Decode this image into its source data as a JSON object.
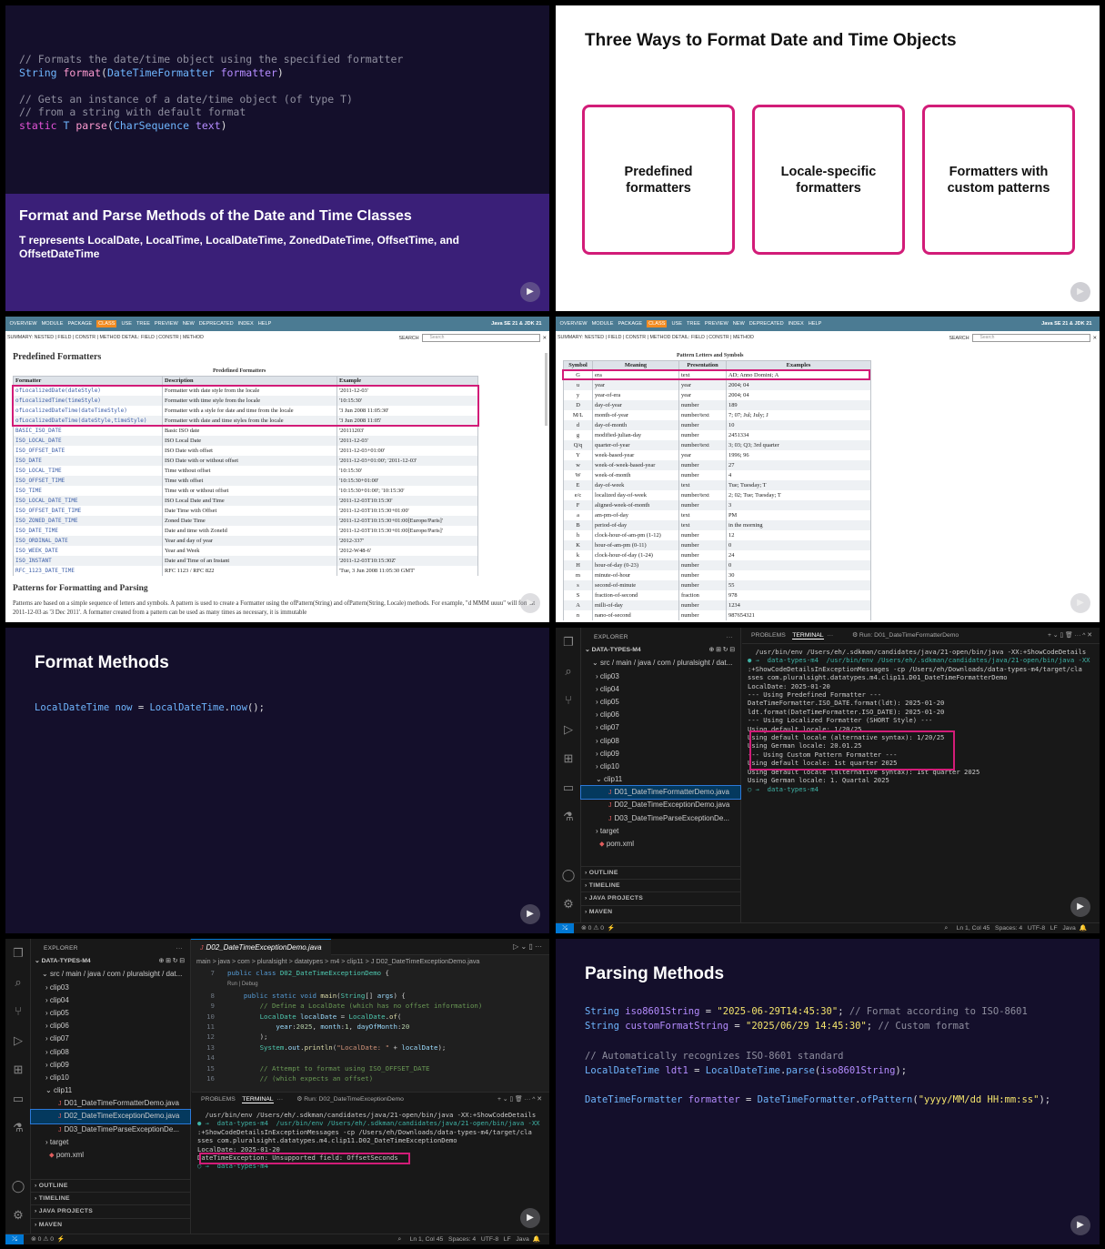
{
  "p1": {
    "code": [
      {
        "comment": "// Formats the date/time object using the specified formatter"
      },
      {
        "sig": [
          "String",
          "format",
          "DateTimeFormatter",
          "formatter"
        ]
      },
      {
        "comment": "// Gets an instance of a date/time object (of type T)"
      },
      {
        "comment": "// from a string with default format"
      },
      {
        "sig2": [
          "static",
          "T",
          "parse",
          "CharSequence",
          "text"
        ]
      }
    ],
    "title": "Format and Parse Methods of the Date and Time Classes",
    "desc": "T represents LocalDate, LocalTime, LocalDateTime, ZonedDateTime, OffsetTime, and OffsetDateTime"
  },
  "p2": {
    "title": "Three Ways to Format Date and Time Objects",
    "boxes": [
      "Predefined formatters",
      "Locale-specific formatters",
      "Formatters with custom patterns"
    ]
  },
  "javadoc": {
    "nav": [
      "OVERVIEW",
      "MODULE",
      "PACKAGE",
      "CLASS",
      "USE",
      "TREE",
      "PREVIEW",
      "NEW",
      "DEPRECATED",
      "INDEX",
      "HELP"
    ],
    "brand": "Java SE 21 & JDK 21",
    "subnav": "SUMMARY: NESTED | FIELD | CONSTR | METHOD     DETAIL: FIELD | CONSTR | METHOD",
    "search_label": "SEARCH",
    "search_placeholder": "Search"
  },
  "p3": {
    "heading": "Predefined Formatters",
    "caption": "Predefined Formatters",
    "cols": [
      "Formatter",
      "Description",
      "Example"
    ],
    "rows": [
      [
        "ofLocalizedDate(dateStyle)",
        "Formatter with date style from the locale",
        "'2011-12-03'"
      ],
      [
        "ofLocalizedTime(timeStyle)",
        "Formatter with time style from the locale",
        "'10:15:30'"
      ],
      [
        "ofLocalizedDateTime(dateTimeStyle)",
        "Formatter with a style for date and time from the locale",
        "'3 Jun 2008 11:05:30'"
      ],
      [
        "ofLocalizedDateTime(dateStyle,timeStyle)",
        "Formatter with date and time styles from the locale",
        "'3 Jun 2008 11:05'"
      ],
      [
        "BASIC_ISO_DATE",
        "Basic ISO date",
        "'20111203'"
      ],
      [
        "ISO_LOCAL_DATE",
        "ISO Local Date",
        "'2011-12-03'"
      ],
      [
        "ISO_OFFSET_DATE",
        "ISO Date with offset",
        "'2011-12-03+01:00'"
      ],
      [
        "ISO_DATE",
        "ISO Date with or without offset",
        "'2011-12-03+01:00'; '2011-12-03'"
      ],
      [
        "ISO_LOCAL_TIME",
        "Time without offset",
        "'10:15:30'"
      ],
      [
        "ISO_OFFSET_TIME",
        "Time with offset",
        "'10:15:30+01:00'"
      ],
      [
        "ISO_TIME",
        "Time with or without offset",
        "'10:15:30+01:00'; '10:15:30'"
      ],
      [
        "ISO_LOCAL_DATE_TIME",
        "ISO Local Date and Time",
        "'2011-12-03T10:15:30'"
      ],
      [
        "ISO_OFFSET_DATE_TIME",
        "Date Time with Offset",
        "'2011-12-03T10:15:30+01:00'"
      ],
      [
        "ISO_ZONED_DATE_TIME",
        "Zoned Date Time",
        "'2011-12-03T10:15:30+01:00[Europe/Paris]'"
      ],
      [
        "ISO_DATE_TIME",
        "Date and time with ZoneId",
        "'2011-12-03T10:15:30+01:00[Europe/Paris]'"
      ],
      [
        "ISO_ORDINAL_DATE",
        "Year and day of year",
        "'2012-337'"
      ],
      [
        "ISO_WEEK_DATE",
        "Year and Week",
        "'2012-W48-6'"
      ],
      [
        "ISO_INSTANT",
        "Date and Time of an Instant",
        "'2011-12-03T10:15:30Z'"
      ],
      [
        "RFC_1123_DATE_TIME",
        "RFC 1123 / RFC 822",
        "'Tue, 3 Jun 2008 11:05:30 GMT'"
      ]
    ],
    "heading2": "Patterns for Formatting and Parsing",
    "para": "Patterns are based on a simple sequence of letters and symbols. A pattern is used to create a Formatter using the ofPattern(String) and ofPattern(String, Locale) methods. For example, \"d MMM uuuu\" will format 2011-12-03 as '3 Dec 2011'. A formatter created from a pattern can be used as many times as necessary, it is immutable"
  },
  "p4": {
    "caption": "Pattern Letters and Symbols",
    "cols": [
      "Symbol",
      "Meaning",
      "Presentation",
      "Examples"
    ],
    "rows": [
      [
        "G",
        "era",
        "text",
        "AD; Anno Domini; A"
      ],
      [
        "u",
        "year",
        "year",
        "2004; 04"
      ],
      [
        "y",
        "year-of-era",
        "year",
        "2004; 04"
      ],
      [
        "D",
        "day-of-year",
        "number",
        "189"
      ],
      [
        "M/L",
        "month-of-year",
        "number/text",
        "7; 07; Jul; July; J"
      ],
      [
        "d",
        "day-of-month",
        "number",
        "10"
      ],
      [
        "g",
        "modified-julian-day",
        "number",
        "2451334"
      ],
      [
        "Q/q",
        "quarter-of-year",
        "number/text",
        "3; 03; Q3; 3rd quarter"
      ],
      [
        "Y",
        "week-based-year",
        "year",
        "1996; 96"
      ],
      [
        "w",
        "week-of-week-based-year",
        "number",
        "27"
      ],
      [
        "W",
        "week-of-month",
        "number",
        "4"
      ],
      [
        "E",
        "day-of-week",
        "text",
        "Tue; Tuesday; T"
      ],
      [
        "e/c",
        "localized day-of-week",
        "number/text",
        "2; 02; Tue; Tuesday; T"
      ],
      [
        "F",
        "aligned-week-of-month",
        "number",
        "3"
      ],
      [
        "a",
        "am-pm-of-day",
        "text",
        "PM"
      ],
      [
        "B",
        "period-of-day",
        "text",
        "in the morning"
      ],
      [
        "h",
        "clock-hour-of-am-pm (1-12)",
        "number",
        "12"
      ],
      [
        "K",
        "hour-of-am-pm (0-11)",
        "number",
        "0"
      ],
      [
        "k",
        "clock-hour-of-day (1-24)",
        "number",
        "24"
      ],
      [
        "H",
        "hour-of-day (0-23)",
        "number",
        "0"
      ],
      [
        "m",
        "minute-of-hour",
        "number",
        "30"
      ],
      [
        "s",
        "second-of-minute",
        "number",
        "55"
      ],
      [
        "S",
        "fraction-of-second",
        "fraction",
        "978"
      ],
      [
        "A",
        "milli-of-day",
        "number",
        "1234"
      ],
      [
        "n",
        "nano-of-second",
        "number",
        "987654321"
      ]
    ]
  },
  "p5": {
    "title": "Format Methods",
    "code": [
      "LocalDateTime",
      "now",
      "=",
      "LocalDateTime",
      ".",
      "now",
      "();"
    ]
  },
  "vscode": {
    "explorer": "EXPLORER",
    "project": "DATA-TYPES-M4",
    "src_path": "src / main / java / com / pluralsight / dat...",
    "folders": [
      "clip03",
      "clip04",
      "clip05",
      "clip06",
      "clip07",
      "clip08",
      "clip09",
      "clip10",
      "clip11"
    ],
    "files": [
      "D01_DateTimeFormatterDemo.java",
      "D02_DateTimeExceptionDemo.java",
      "D03_DateTimeParseExceptionDe..."
    ],
    "target": "target",
    "pom": "pom.xml",
    "sections": [
      "OUTLINE",
      "TIMELINE",
      "JAVA PROJECTS",
      "MAVEN"
    ],
    "problems": "PROBLEMS",
    "terminal": "TERMINAL",
    "status": [
      "Ln 1, Col 45",
      "Spaces: 4",
      "UTF-8",
      "LF",
      "Java"
    ],
    "errors": "0 ⚠ 0"
  },
  "p6": {
    "run_title": "Run: D01_DateTimeFormatterDemo",
    "lines": [
      "  /usr/bin/env /Users/eh/.sdkman/candidates/java/21-open/bin/java -XX:+ShowCodeDetails",
      "● →  data-types-m4  /usr/bin/env /Users/eh/.sdkman/candidates/java/21-open/bin/java -XX",
      ":+ShowCodeDetailsInExceptionMessages -cp /Users/eh/Downloads/data-types-m4/target/cla",
      "sses com.pluralsight.datatypes.m4.clip11.D01_DateTimeFormatterDemo",
      "LocalDate: 2025-01-20",
      "",
      "--- Using Predefined Formatter ---",
      "DateTimeFormatter.ISO_DATE.format(ldt): 2025-01-20",
      "ldt.format(DateTimeFormatter.ISO_DATE): 2025-01-20",
      "",
      "--- Using Localized Formatter (SHORT Style) ---",
      "Using default locale: 1/20/25",
      "Using default locale (alternative syntax): 1/20/25",
      "Using German locale: 20.01.25",
      "",
      "--- Using Custom Pattern Formatter ---",
      "Using default locale: 1st quarter 2025",
      "Using default locale (alternative syntax): 1st quarter 2025",
      "Using German locale: 1. Quartal 2025",
      "○ →  data-types-m4"
    ]
  },
  "p7": {
    "tab": "D02_DateTimeExceptionDemo.java",
    "breadcrumb": "main > java > com > pluralsight > datatypes > m4 > clip11 > J D02_DateTimeExceptionDemo.java",
    "codelens": "Run | Debug",
    "run_title": "Run: D02_DateTimeExceptionDemo",
    "term_lines": [
      "  /usr/bin/env /Users/eh/.sdkman/candidates/java/21-open/bin/java -XX:+ShowCodeDetails",
      "● →  data-types-m4  /usr/bin/env /Users/eh/.sdkman/candidates/java/21-open/bin/java -XX",
      ":+ShowCodeDetailsInExceptionMessages -cp /Users/eh/Downloads/data-types-m4/target/cla",
      "sses com.pluralsight.datatypes.m4.clip11.D02_DateTimeExceptionDemo",
      "LocalDate: 2025-01-20",
      "DateTimeException: Unsupported field: OffsetSeconds",
      "○ →  data-types-m4"
    ]
  },
  "p8": {
    "title": "Parsing Methods"
  }
}
